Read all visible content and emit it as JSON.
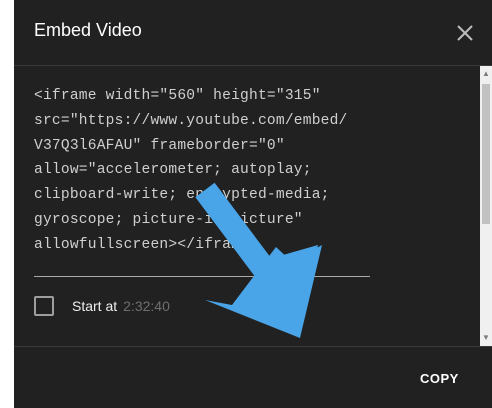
{
  "dialog": {
    "title": "Embed Video",
    "close_icon": "close-icon"
  },
  "embed_code": {
    "lines": [
      "<iframe width=\"560\" height=\"315\"",
      "src=\"https://www.youtube.com/embed/",
      "V37Q3l6AFAU\" frameborder=\"0\"",
      "allow=\"accelerometer; autoplay;",
      "clipboard-write; encrypted-media;",
      "gyroscope; picture-in-picture\"",
      "allowfullscreen></iframe>"
    ]
  },
  "start_at": {
    "label": "Start at",
    "time": "2:32:40",
    "checked": false
  },
  "footer": {
    "copy_label": "COPY"
  },
  "colors": {
    "dialog_bg": "#212121",
    "arrow": "#4aa5e8"
  }
}
